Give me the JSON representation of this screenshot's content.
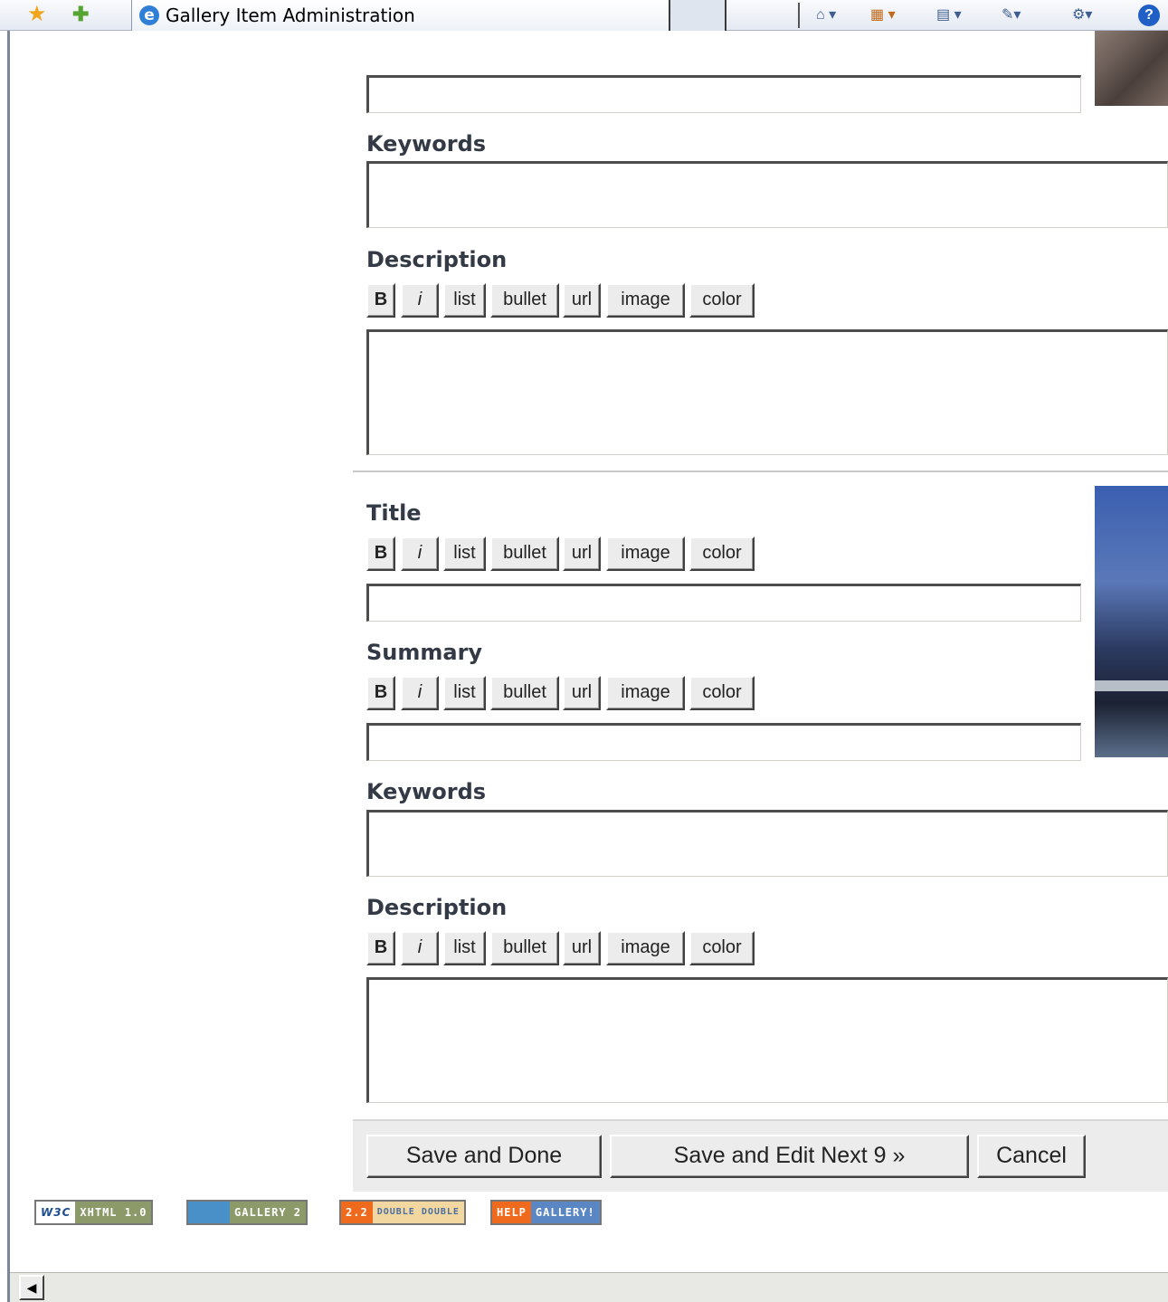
{
  "browser": {
    "tab_title": "Gallery Item Administration",
    "ie_icon": "e",
    "toolbar_icons": [
      "home-icon",
      "feeds-icon",
      "print-icon",
      "page-icon",
      "tools-icon",
      "help-icon"
    ]
  },
  "markup_buttons": {
    "bold": "B",
    "italic": "i",
    "list": "list",
    "bullet": "bullet",
    "url": "url",
    "image": "image",
    "color": "color"
  },
  "item1": {
    "keywords_label": "Keywords",
    "description_label": "Description",
    "summary_value": "",
    "keywords_value": "",
    "description_value": ""
  },
  "item2": {
    "title_label": "Title",
    "summary_label": "Summary",
    "keywords_label": "Keywords",
    "description_label": "Description",
    "title_value": "",
    "summary_value": "",
    "keywords_value": "",
    "description_value": ""
  },
  "actions": {
    "save_done": "Save and Done",
    "save_next": "Save and Edit Next 9 »",
    "cancel": "Cancel"
  },
  "badges": {
    "w3c": {
      "left": "W3C",
      "right": "XHTML 1.0"
    },
    "gallery2": {
      "right": "GALLERY 2"
    },
    "doubledouble": {
      "left": "2.2",
      "right": "DOUBLE DOUBLE"
    },
    "help": {
      "left": "HELP",
      "right": "GALLERY!"
    }
  },
  "colors": {
    "label": "#333a46",
    "button_face": "#ececec",
    "ie_blue": "#2f7fd6"
  }
}
